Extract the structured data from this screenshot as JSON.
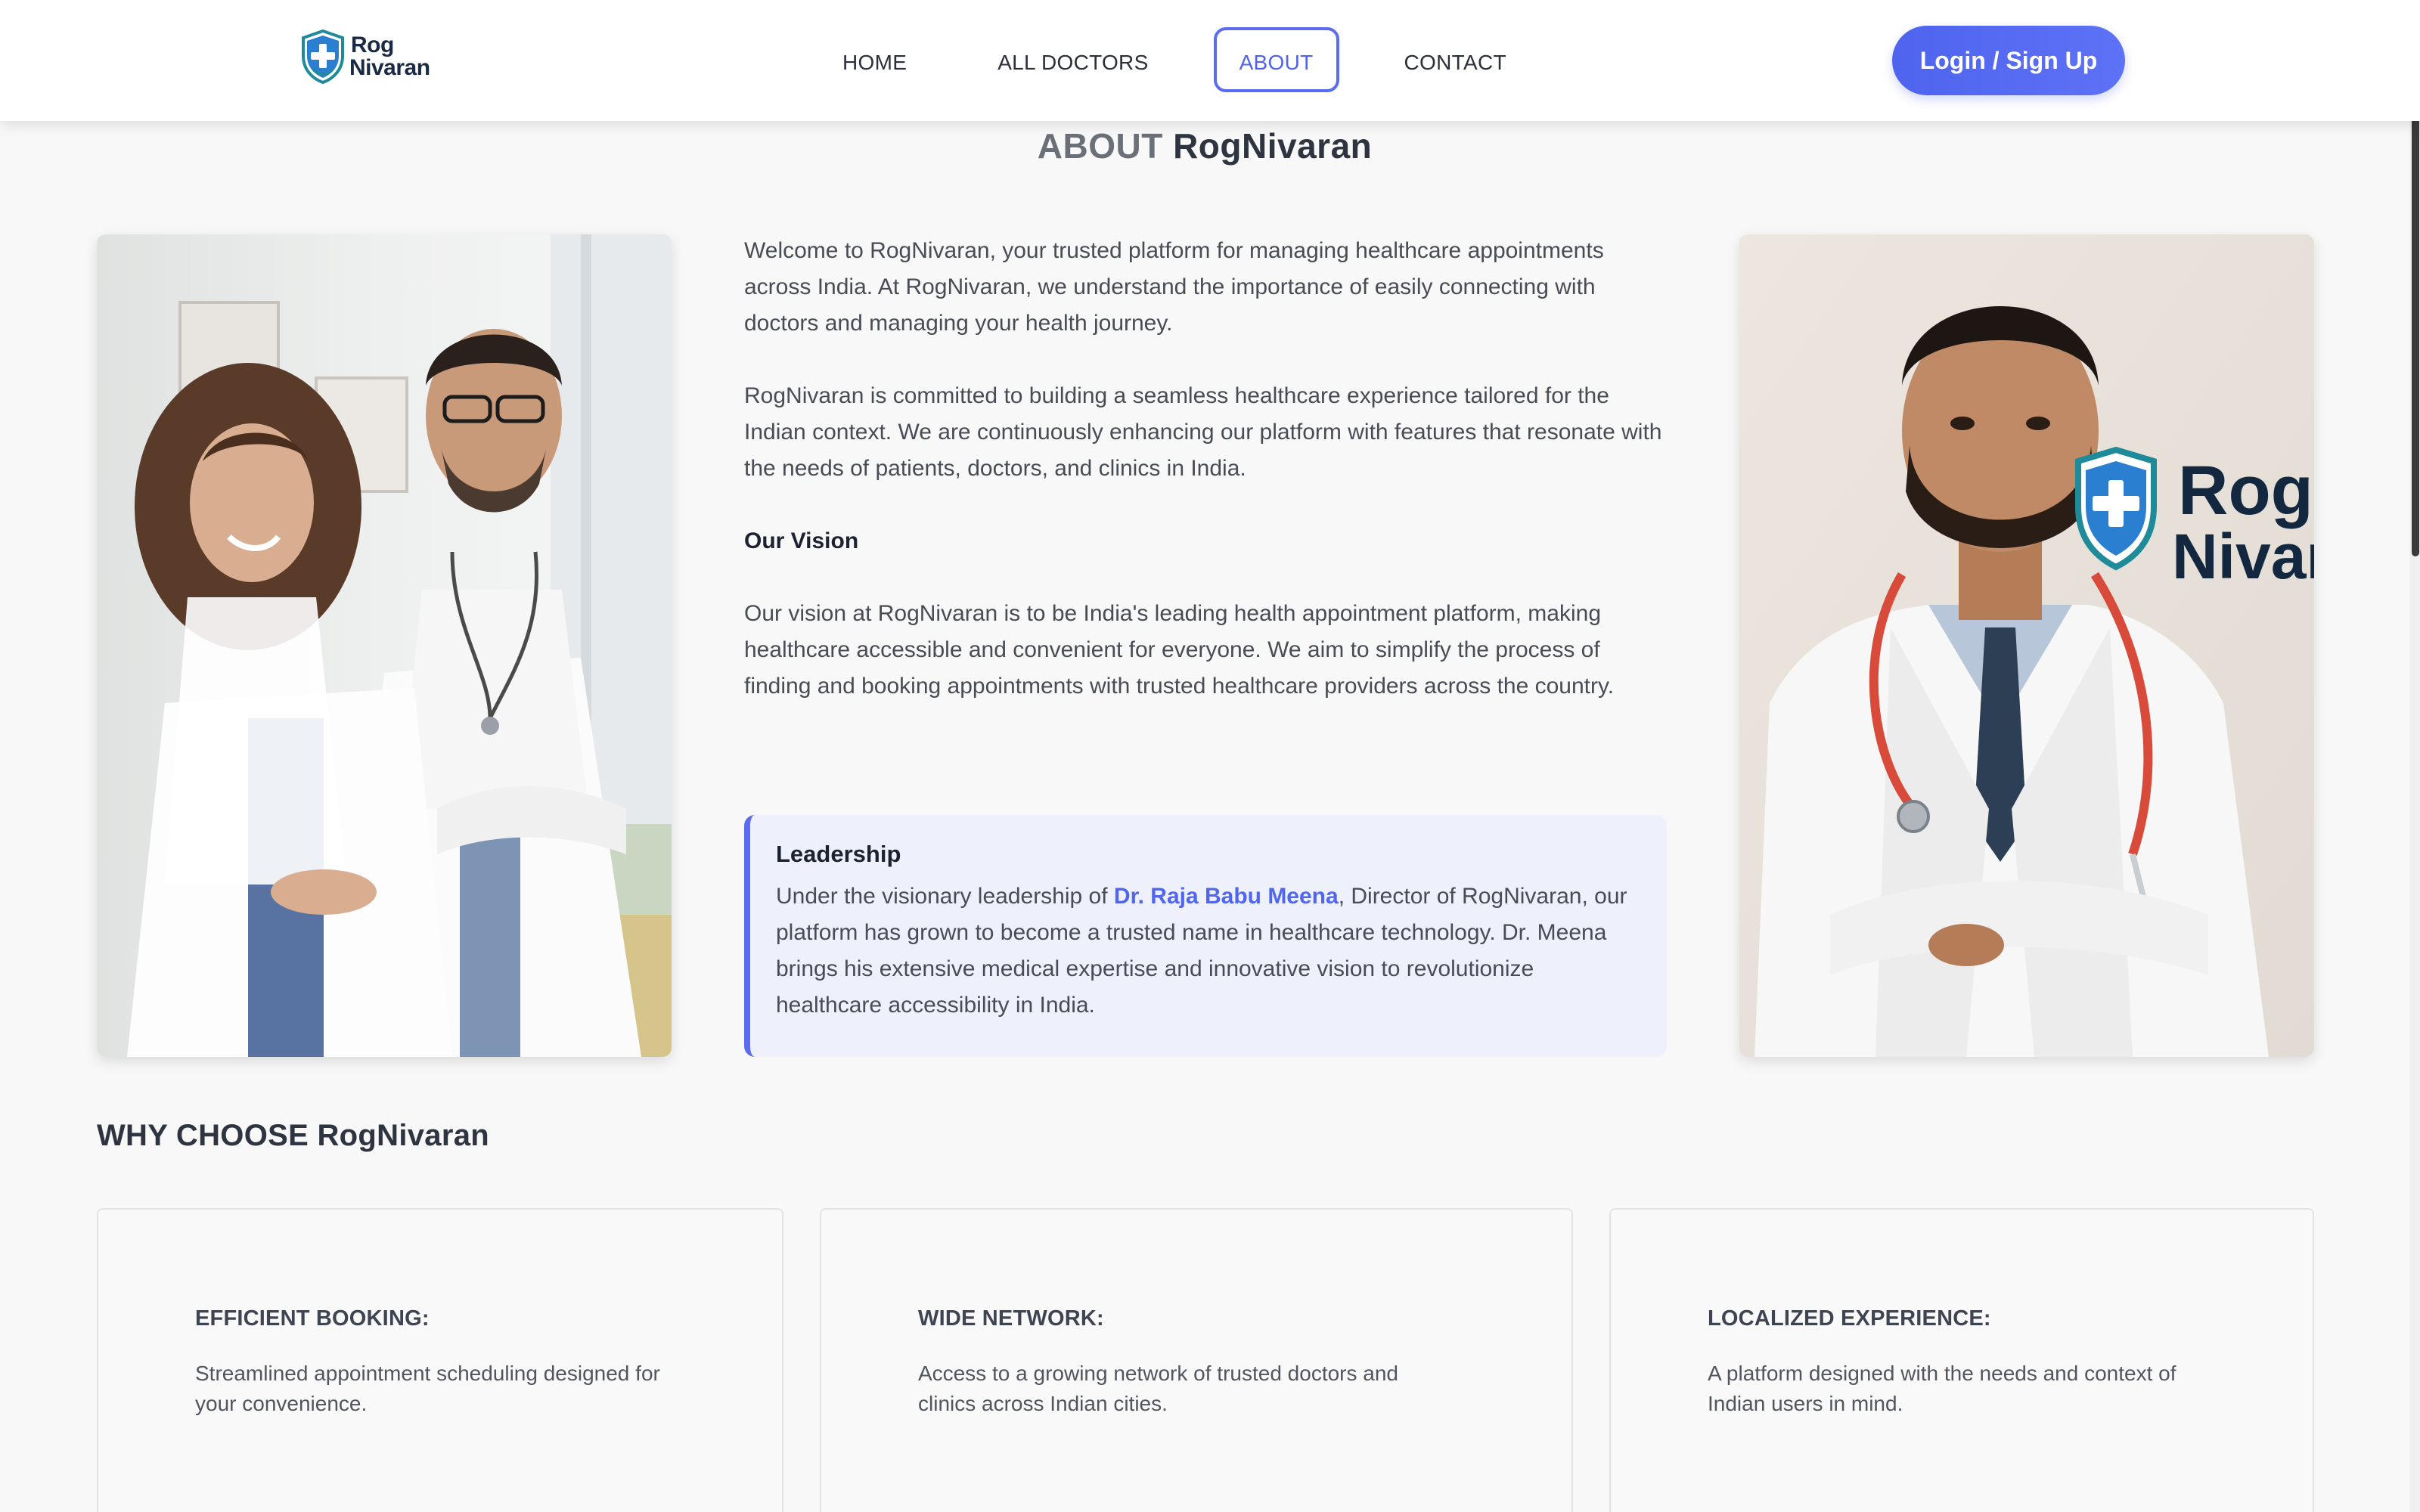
{
  "brand": {
    "line1": "Rog",
    "line2": "Nivaran"
  },
  "nav": {
    "items": [
      {
        "label": "HOME",
        "active": false
      },
      {
        "label": "ALL DOCTORS",
        "active": false
      },
      {
        "label": "ABOUT",
        "active": true
      },
      {
        "label": "CONTACT",
        "active": false
      }
    ],
    "login_label": "Login / Sign Up"
  },
  "about": {
    "title_prefix": "ABOUT",
    "title_brand": "RogNivaran",
    "para1": "Welcome to RogNivaran, your trusted platform for managing healthcare appointments across India. At RogNivaran, we understand the importance of easily connecting with doctors and managing your health journey.",
    "para2": "RogNivaran is committed to building a seamless healthcare experience tailored for the Indian context. We are continuously enhancing our platform with features that resonate with the needs of patients, doctors, and clinics in India.",
    "vision_heading": "Our Vision",
    "vision_text": "Our vision at RogNivaran is to be India's leading health appointment platform, making healthcare accessible and convenient for everyone. We aim to simplify the process of finding and booking appointments with trusted healthcare providers across the country.",
    "leadership": {
      "heading": "Leadership",
      "text_before": "Under the visionary leadership of ",
      "leader_name": "Dr. Raja Babu Meena",
      "text_after": ", Director of RogNivaran, our platform has grown to become a trusted name in healthcare technology. Dr. Meena brings his extensive medical expertise and innovative vision to revolutionize healthcare accessibility in India."
    },
    "right_image_logo": {
      "line1": "Rog",
      "line2": "Nivarar"
    }
  },
  "why": {
    "title_prefix": "WHY CHOOSE",
    "title_brand": "RogNivaran",
    "cards": [
      {
        "title": "EFFICIENT BOOKING:",
        "text": "Streamlined appointment scheduling designed for your convenience."
      },
      {
        "title": "WIDE NETWORK:",
        "text": "Access to a growing network of trusted doctors and clinics across Indian cities."
      },
      {
        "title": "LOCALIZED EXPERIENCE:",
        "text": "A platform designed with the needs and context of Indian users in mind."
      }
    ]
  },
  "colors": {
    "accent": "#5b6cf0",
    "brand_dark": "#1b2a44",
    "brand_teal": "#1f8a9a",
    "background": "#f8f8f8"
  }
}
